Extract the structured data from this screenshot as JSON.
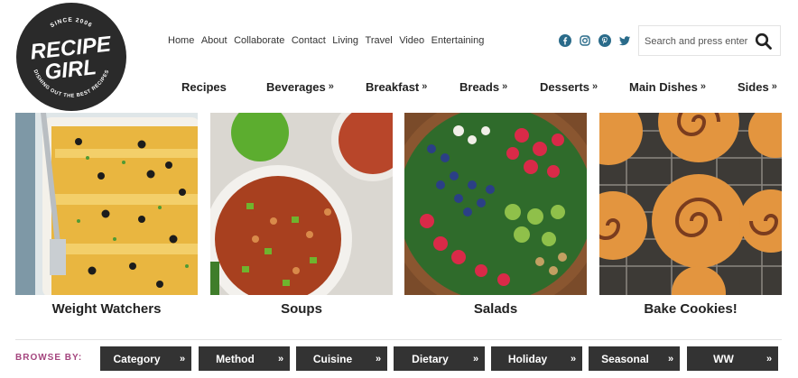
{
  "logo": {
    "top_text": "SINCE 2006",
    "line1": "RECIPE",
    "line2": "GIRL",
    "tagline": "DISHING OUT THE BEST RECIPES"
  },
  "top_links": [
    "Home",
    "About",
    "Collaborate",
    "Contact",
    "Living",
    "Travel",
    "Video",
    "Entertaining"
  ],
  "social_icons": [
    "facebook-icon",
    "instagram-icon",
    "pinterest-icon",
    "twitter-icon"
  ],
  "search": {
    "placeholder": "Search and press enter"
  },
  "main_nav": [
    {
      "label": "Recipes",
      "has_dropdown": false
    },
    {
      "label": "Beverages",
      "has_dropdown": true
    },
    {
      "label": "Breakfast",
      "has_dropdown": true
    },
    {
      "label": "Breads",
      "has_dropdown": true
    },
    {
      "label": "Desserts",
      "has_dropdown": true
    },
    {
      "label": "Main Dishes",
      "has_dropdown": true
    },
    {
      "label": "Sides",
      "has_dropdown": true
    }
  ],
  "tiles": [
    {
      "label": "Weight Watchers"
    },
    {
      "label": "Soups"
    },
    {
      "label": "Salads"
    },
    {
      "label": "Bake Cookies!"
    }
  ],
  "browse": {
    "label": "BROWSE BY:",
    "filters": [
      "Category",
      "Method",
      "Cuisine",
      "Dietary",
      "Holiday",
      "Seasonal",
      "WW"
    ]
  },
  "colors": {
    "accent": "#a4457e",
    "social": "#2a6b8a",
    "filter_bg": "#333333"
  }
}
